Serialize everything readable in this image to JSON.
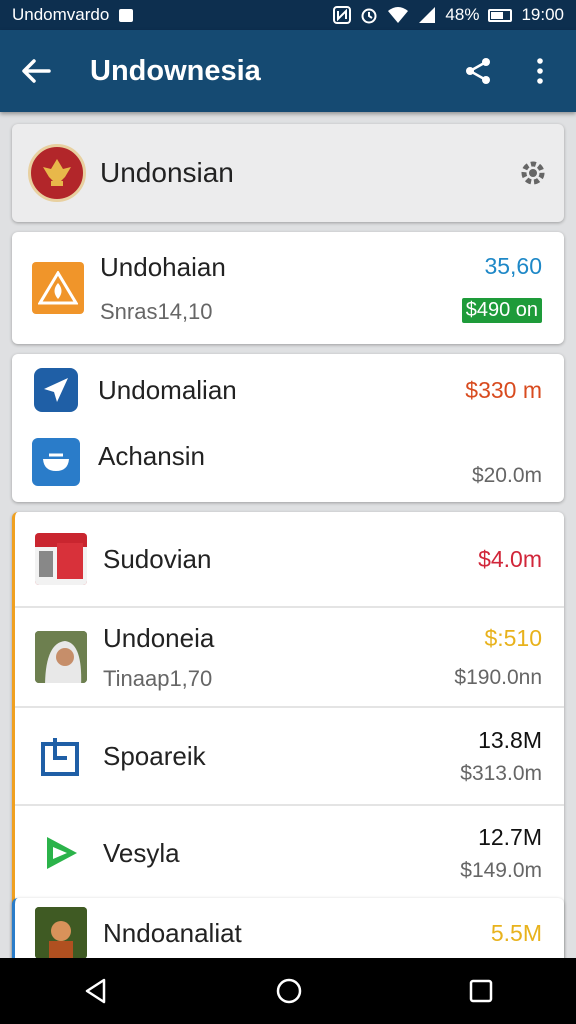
{
  "status_bar": {
    "left_text": "Undomvardo",
    "battery": "48%",
    "time": "19:00"
  },
  "app_bar": {
    "title": "Undownesia"
  },
  "header": {
    "name": "Undonsian"
  },
  "rows": [
    {
      "name": "Undohaian",
      "sub": "Snras14,10",
      "value": "35,60",
      "value_color": "#1e88c7",
      "badge": "$490 on",
      "badge_color": "#1e9b3a"
    },
    {
      "name": "Undomalian",
      "value": "$330 m",
      "value_color": "#d84b1f"
    },
    {
      "name": "Achansin",
      "value2": "$20.0m"
    },
    {
      "name": "Sudovian",
      "value": "$4.0m",
      "value_color": "#d1263a"
    },
    {
      "name": "Undoneia",
      "sub": "Tinaap1,70",
      "value": "$:510",
      "value_color": "#e8b21c",
      "value2": "$190.0nn"
    },
    {
      "name": "Spoareik",
      "value": "13.8M",
      "value_color": "#111111",
      "value2": "$313.0m"
    },
    {
      "name": "Vesyla",
      "value": "12.7M",
      "value_color": "#111111",
      "value2": "$149.0m"
    },
    {
      "name": "Nndoanaliat",
      "value": "5.5M",
      "value_color": "#e8b21c"
    }
  ],
  "icons": {
    "back": "arrow-left",
    "share": "share",
    "more": "more-vertical",
    "settings": "gear",
    "nav_back": "triangle-back",
    "nav_home": "circle-home",
    "nav_recent": "square-recent"
  }
}
